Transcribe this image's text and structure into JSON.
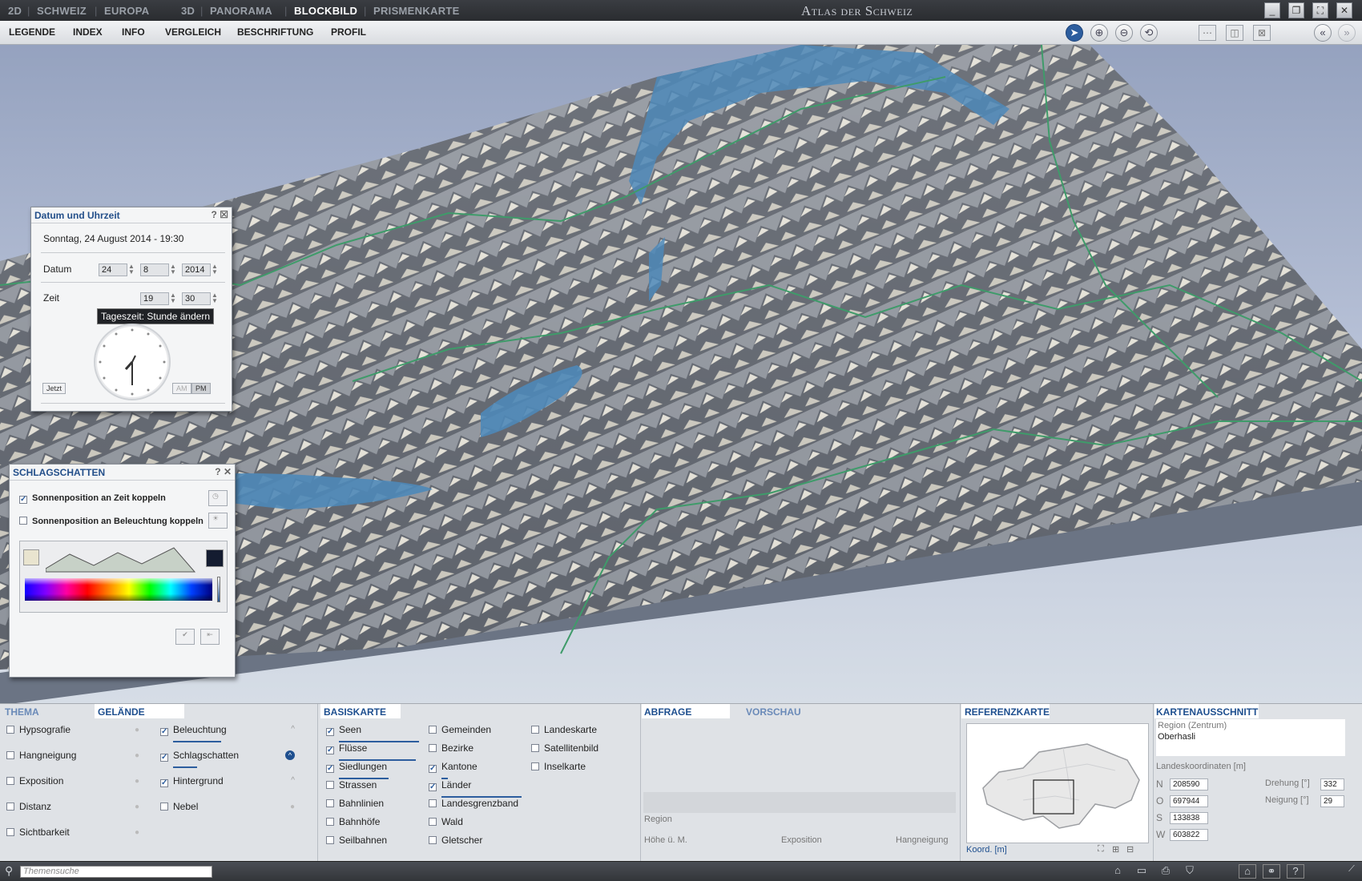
{
  "titlebar": {
    "view_tabs": [
      "2D",
      "SCHWEIZ",
      "EUROPA",
      "3D",
      "PANORAMA",
      "BLOCKBILD",
      "PRISMENKARTE"
    ],
    "active_tab": "BLOCKBILD",
    "app_title": "Atlas der Schweiz"
  },
  "menu": {
    "items": [
      "LEGENDE",
      "INDEX",
      "INFO",
      "VERGLEICH",
      "BESCHRIFTUNG",
      "PROFIL"
    ]
  },
  "datetime_panel": {
    "title": "Datum und Uhrzeit",
    "date_text": "Sonntag, 24 August 2014 - 19:30",
    "datum_label": "Datum",
    "day": "24",
    "month": "8",
    "year": "2014",
    "zeit_label": "Zeit",
    "hour": "19",
    "minute": "30",
    "tooltip": "Tageszeit: Stunde ändern",
    "now_button": "Jetzt",
    "am": "AM",
    "pm": "PM"
  },
  "shadow_panel": {
    "title": "SCHLAGSCHATTEN",
    "opt1": "Sonnenposition an Zeit koppeln",
    "opt2": "Sonnenposition an Beleuchtung koppeln"
  },
  "thema": {
    "tab_thema": "THEMA",
    "tab_gelaende": "GELÄNDE",
    "left_items": [
      "Hypsografie",
      "Hangneigung",
      "Exposition",
      "Distanz",
      "Sichtbarkeit"
    ],
    "right_items": [
      {
        "label": "Beleuchtung",
        "checked": true
      },
      {
        "label": "Schlagschatten",
        "checked": true
      },
      {
        "label": "Hintergrund",
        "checked": true
      },
      {
        "label": "Nebel",
        "checked": false
      }
    ]
  },
  "basiskarte": {
    "title": "BASISKARTE",
    "col1": [
      {
        "label": "Seen",
        "checked": true
      },
      {
        "label": "Flüsse",
        "checked": true
      },
      {
        "label": "Siedlungen",
        "checked": true
      },
      {
        "label": "Strassen",
        "checked": false
      },
      {
        "label": "Bahnlinien",
        "checked": false
      },
      {
        "label": "Bahnhöfe",
        "checked": false
      },
      {
        "label": "Seilbahnen",
        "checked": false
      }
    ],
    "col2": [
      {
        "label": "Gemeinden",
        "checked": false
      },
      {
        "label": "Bezirke",
        "checked": false
      },
      {
        "label": "Kantone",
        "checked": true
      },
      {
        "label": "Länder",
        "checked": true
      },
      {
        "label": "Landesgrenzband",
        "checked": false
      },
      {
        "label": "Wald",
        "checked": false
      },
      {
        "label": "Gletscher",
        "checked": false
      }
    ],
    "col3": [
      {
        "label": "Landeskarte",
        "checked": false
      },
      {
        "label": "Satellitenbild",
        "checked": false
      },
      {
        "label": "Inselkarte",
        "checked": false
      }
    ]
  },
  "abfrage": {
    "tab_abfrage": "ABFRAGE",
    "tab_vorschau": "VORSCHAU",
    "region_label": "Region",
    "col_hoehe": "Höhe ü. M.",
    "col_expo": "Exposition",
    "col_hang": "Hangneigung"
  },
  "referenzkarte": {
    "title": "REFERENZKARTE",
    "koord": "Koord. [m]"
  },
  "kartenausschnitt": {
    "title": "KARTENAUSSCHNITT",
    "region_label": "Region (Zentrum)",
    "region_value": "Oberhasli",
    "coords_label": "Landeskoordinaten [m]",
    "n_label": "N",
    "n_value": "208590",
    "o_label": "O",
    "o_value": "697944",
    "s_label": "S",
    "s_value": "133838",
    "w_label": "W",
    "w_value": "603822",
    "drehung_label": "Drehung [°]",
    "drehung_value": "332",
    "neigung_label": "Neigung [°]",
    "neigung_value": "29"
  },
  "status": {
    "search_placeholder": "Themensuche"
  }
}
